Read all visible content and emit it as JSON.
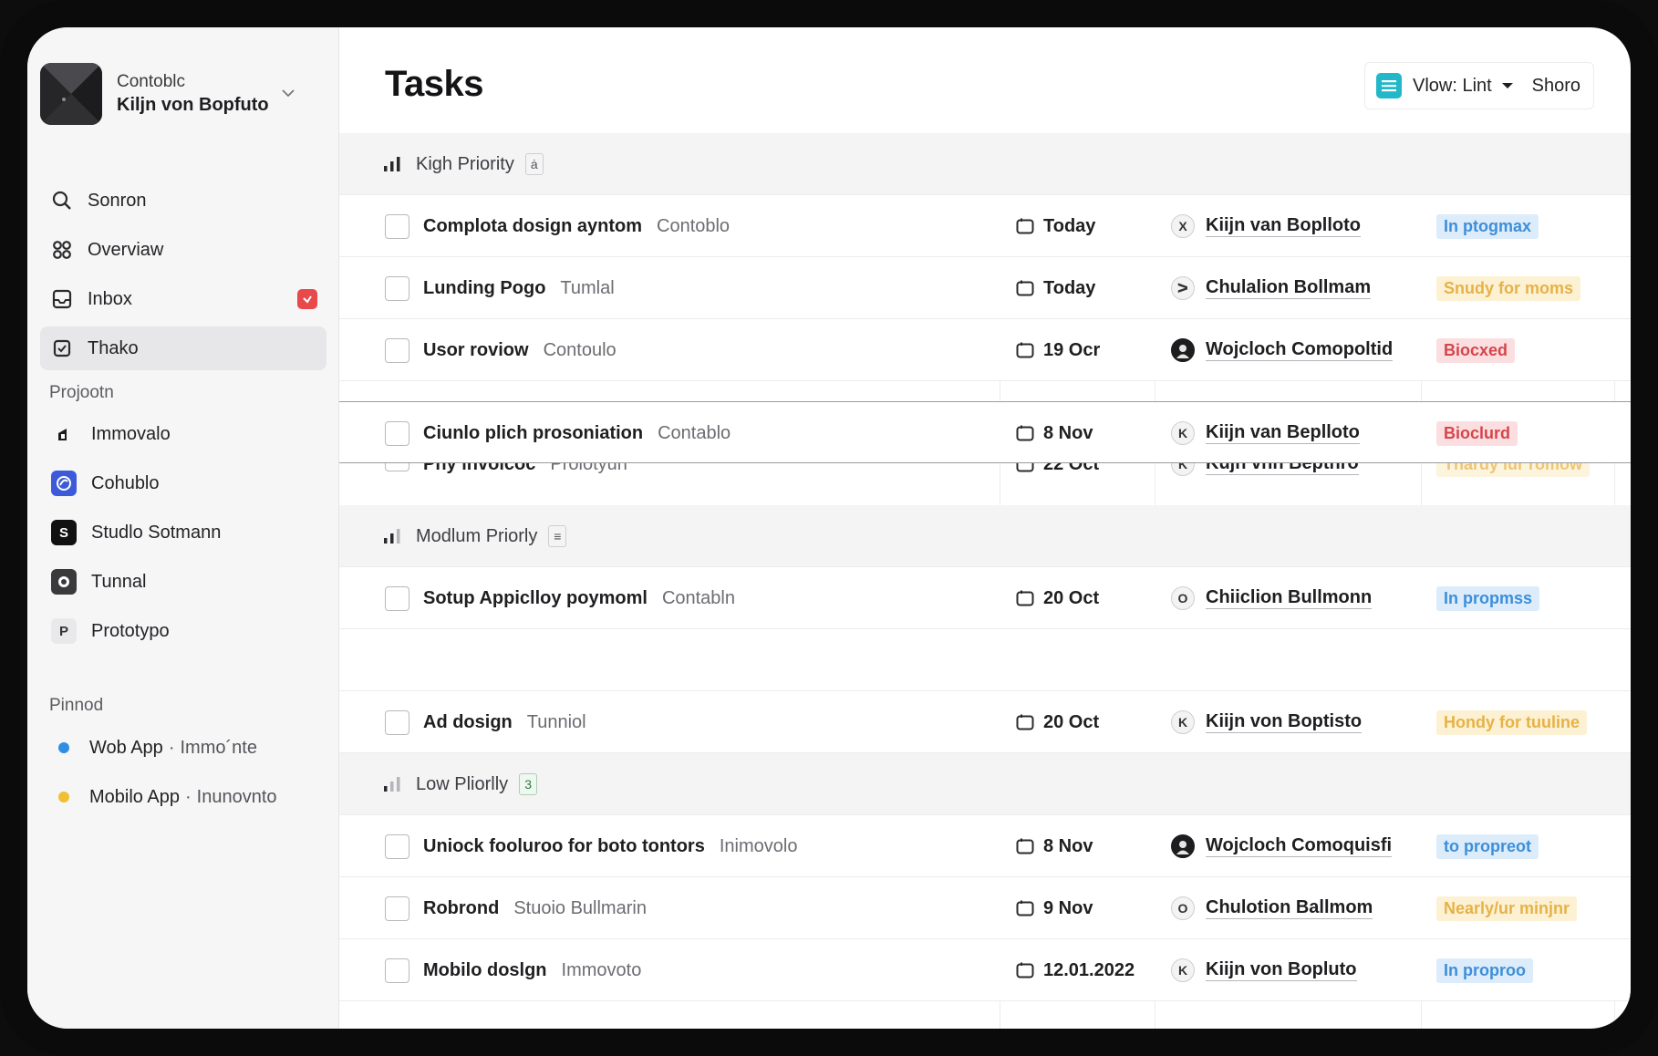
{
  "workspace": {
    "name": "Contoblc",
    "user": "Kiljn von Bopfuto"
  },
  "nav": [
    {
      "key": "search",
      "label": "Sonron",
      "icon": "search-icon"
    },
    {
      "key": "overview",
      "label": "Overviaw",
      "icon": "grid-icon"
    },
    {
      "key": "inbox",
      "label": "Inbox",
      "icon": "inbox-icon",
      "badge": true
    },
    {
      "key": "tasks",
      "label": "Thako",
      "icon": "task-check-icon",
      "active": true
    }
  ],
  "projects": {
    "heading": "Projootn",
    "items": [
      {
        "label": "Immovalo",
        "letter": "",
        "color": "#ffffff"
      },
      {
        "label": "Cohublo",
        "letter": "",
        "color": "#3d5bd9"
      },
      {
        "label": "Studlo Sotmann",
        "letter": "S",
        "color": "#111111"
      },
      {
        "label": "Tunnal",
        "letter": "",
        "color": "#3a3a3d"
      },
      {
        "label": "Prototypo",
        "letter": "P",
        "color": "#e9e9eb"
      }
    ]
  },
  "pinned": {
    "heading": "Pinnod",
    "items": [
      {
        "label": "Wob App",
        "sub": "Immo´nte",
        "dot": "#2f8de4"
      },
      {
        "label": "Mobilo App",
        "sub": "Inunovnto",
        "dot": "#f0c030"
      }
    ]
  },
  "header": {
    "title": "Tasks",
    "view_label": "Vlow: Lint",
    "share_label": "Shoro"
  },
  "groups": [
    {
      "label": "Kigh Priority",
      "count": "ȧ",
      "tasks": [
        {
          "name": "Complota dosign ayntom",
          "project": "Contoblo",
          "due": "Today",
          "avatar": "X",
          "assignee": "Kiijn van Boplloto",
          "status": "In ptogmax",
          "status_color": "blue"
        },
        {
          "name": "Lunding Pogo",
          "project": "Tumlal",
          "due": "Today",
          "avatar": "ᐳ",
          "assignee": "Chulalion Bollmam",
          "status": "Snudy for moms",
          "status_color": "yellow"
        },
        {
          "name": "Usor roviow",
          "project": "Contoulo",
          "due": "19 Ocr",
          "avatar": "",
          "assignee": "Wojcloch Comopoltid",
          "status": "Biocxed",
          "status_color": "red"
        },
        {
          "name": "Ciunlo plich prosoniation",
          "project": "Contablo",
          "due": "8 Nov",
          "avatar": "K",
          "assignee": "Kiijn van Beplloto",
          "status": "Bioclurd",
          "status_color": "red"
        },
        {
          "name": "Pny invoicoc",
          "project": "Prolotyun",
          "due": "22 Oct",
          "avatar": "K",
          "assignee": "Kujn vnn Beptnro",
          "status": "Thardy lur romow",
          "status_color": "yellow"
        }
      ]
    },
    {
      "label": "Modlum Priorly",
      "count": "≡",
      "tasks": [
        {
          "name": "Sotup Appiclloy poymoml",
          "project": "Contabln",
          "due": "20 Oct",
          "avatar": "O",
          "assignee": "Chiiclion Bullmonn",
          "status": "In propmss",
          "status_color": "blue"
        },
        {
          "name": "Ad dosign",
          "project": "Tunniol",
          "due": "20 Oct",
          "avatar": "K",
          "assignee": "Kiijn von Boptisto",
          "status": "Hondy for tuuline",
          "status_color": "yellow"
        }
      ]
    },
    {
      "label": "Low Pliorlly",
      "count": "3",
      "tasks": [
        {
          "name": "Uniock fooluroo for boto tontors",
          "project": "Inimovolo",
          "due": "8 Nov",
          "avatar": "",
          "assignee": "Wojcloch Comoquisfi",
          "status": "to propreot",
          "status_color": "blue"
        },
        {
          "name": "Robrond",
          "project": "Stuoio Bullmarin",
          "due": "9 Nov",
          "avatar": "O",
          "assignee": "Chulotion Ballmom",
          "status": "Nearly/ur minjnr",
          "status_color": "yellow"
        },
        {
          "name": "Mobilo doslgn",
          "project": "Immovoto",
          "due": "12.01.2022",
          "avatar": "K",
          "assignee": "Kiijn von Bopluto",
          "status": "In proproo",
          "status_color": "blue"
        }
      ]
    }
  ],
  "colors": {
    "accent": "#22b7c9",
    "inbox_badge": "#e8494b",
    "pill_blue": "#3d8fd9",
    "pill_yellow": "#e6b247",
    "pill_red": "#d5454b"
  }
}
